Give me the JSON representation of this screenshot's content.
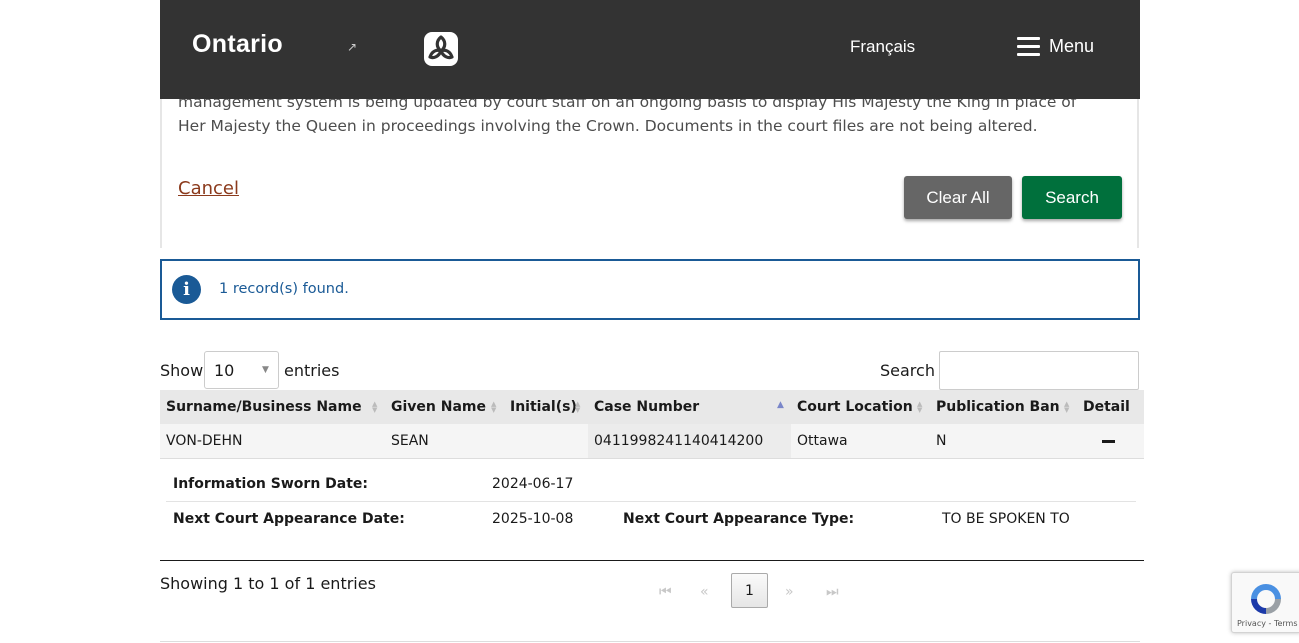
{
  "header": {
    "brand": "Ontario",
    "language_link": "Français",
    "menu_label": "Menu",
    "bg_color": "#333333"
  },
  "notice": {
    "text": "management system is being updated by court staff on an ongoing basis to display His Majesty the King in place of Her Majesty the Queen in proceedings involving the Crown. Documents in the court files are not being altered.",
    "cancel_label": "Cancel",
    "clear_label": "Clear All",
    "search_label": "Search"
  },
  "alert": {
    "icon": "info-icon",
    "text": "1 record(s) found.",
    "color": "#1a5a96"
  },
  "table_controls": {
    "show_label": "Show",
    "entries_value": "10",
    "entries_label": "entries",
    "search_label": "Search",
    "search_value": ""
  },
  "table": {
    "columns": [
      "Surname/Business Name",
      "Given Name",
      "Initial(s)",
      "Case Number",
      "Court Location",
      "Publication Ban",
      "Detail"
    ],
    "rows": [
      {
        "surname": "VON-DEHN",
        "given": "SEAN",
        "initials": "",
        "case_number": "0411998241140414200",
        "location": "Ottawa",
        "pub_ban": "N"
      }
    ],
    "details": {
      "sworn_label": "Information Sworn Date:",
      "sworn_value": "2024-06-17",
      "next_date_label": "Next Court Appearance Date:",
      "next_date_value": "2025-10-08",
      "next_type_label": "Next Court Appearance Type:",
      "next_type_value": "TO BE SPOKEN TO"
    }
  },
  "pagination": {
    "info": "Showing 1 to 1 of 1 entries",
    "current_page": "1"
  },
  "recaptcha": {
    "text": "Privacy - Terms"
  },
  "colors": {
    "search_button": "#00703c",
    "clear_button": "#666666",
    "cancel_link": "#8b3a1c"
  }
}
